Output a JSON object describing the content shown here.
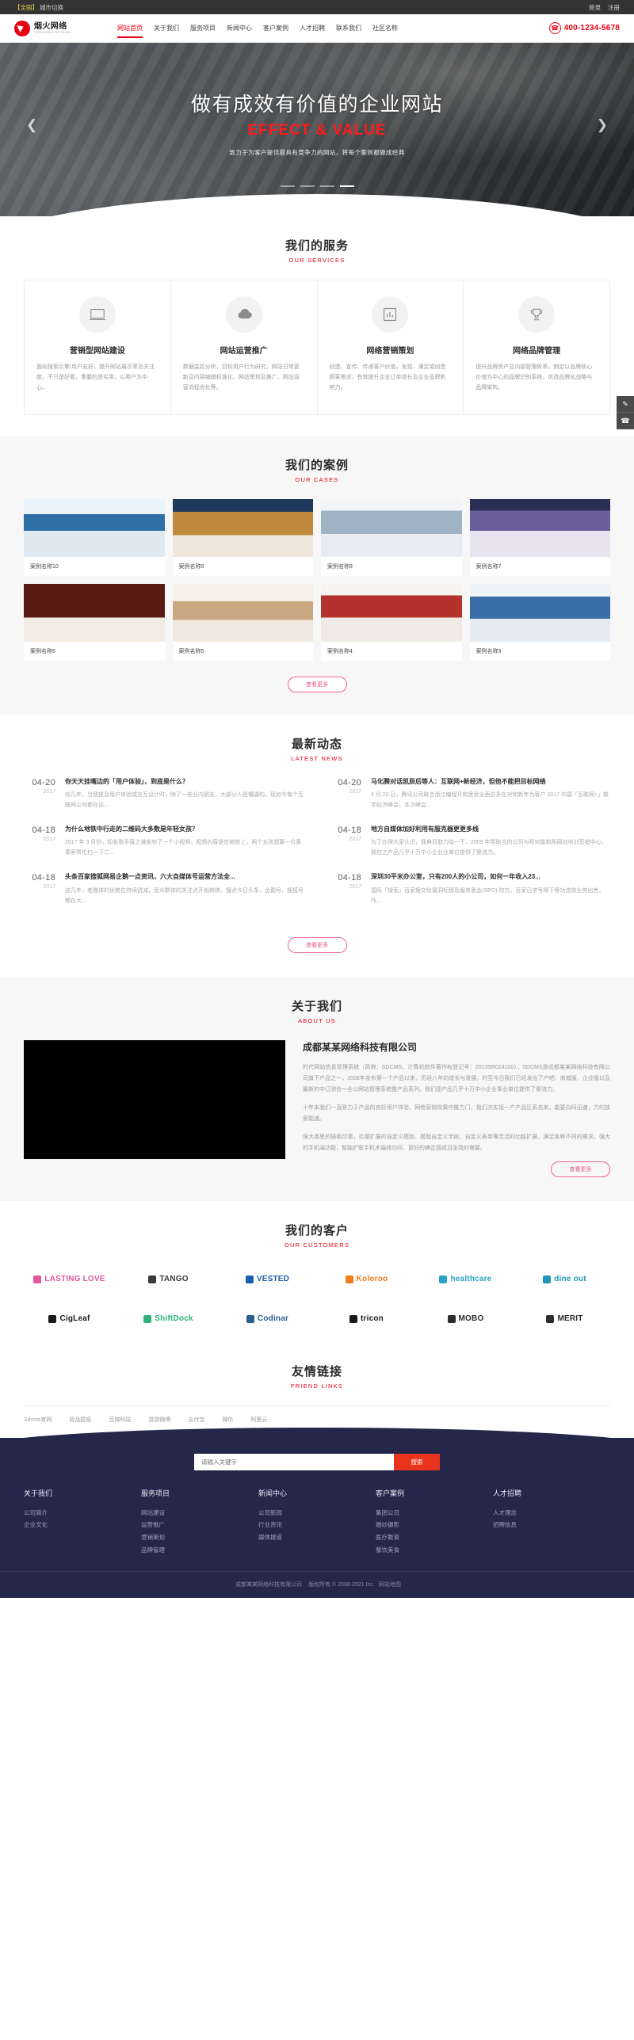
{
  "topbar": {
    "city_tag": "【全国】",
    "city_label": "城市切换",
    "login": "登录",
    "register": "注册"
  },
  "header": {
    "logo_cn": "烟火网络",
    "logo_en": "FIREWORKS NETWORK",
    "nav": [
      {
        "label": "网站首页",
        "active": true
      },
      {
        "label": "关于我们",
        "active": false
      },
      {
        "label": "服务项目",
        "active": false
      },
      {
        "label": "新闻中心",
        "active": false
      },
      {
        "label": "客户案例",
        "active": false
      },
      {
        "label": "人才招聘",
        "active": false
      },
      {
        "label": "联系我们",
        "active": false
      },
      {
        "label": "社区名称",
        "active": false
      }
    ],
    "tel": "400-1234-5678",
    "tel_icon": "phone-icon"
  },
  "hero": {
    "title": "做有成效有价值的企业网站",
    "subtitle": "EFFECT & VALUE",
    "desc": "致力于为客户提供最具有竞争力的网站，将每个案例都做成经典",
    "prev_icon": "chevron-left-icon",
    "next_icon": "chevron-right-icon",
    "dots": 4,
    "active_dot": 3
  },
  "services": {
    "title": "我们的服务",
    "subtitle": "OUR SERVICES",
    "cards": [
      {
        "icon": "laptop-icon",
        "title": "营销型网站建设",
        "desc": "面向搜索引擎/用户友好，提升网站展示率及关注度。不只是好看，重要的是实用，以用户为中心。"
      },
      {
        "icon": "cloud-icon",
        "title": "网站运营推广",
        "desc": "数据监控分析、目标用户行为研究、网站日常更新及内容编辑标准化、网站策划及推广、网站运营流程优化等。"
      },
      {
        "icon": "chart-bar-icon",
        "title": "网络营销策划",
        "desc": "创造、宣传、传递客户价值，发现、满足或创造顾客需求，有效提升企业订单增长及企业品牌影响力。"
      },
      {
        "icon": "trophy-icon",
        "title": "网络品牌管理",
        "desc": "提升品牌资产及内部管理效率，制定以品牌核心价值为中心的品牌识别系统，优选品牌化战略与品牌架构。"
      }
    ]
  },
  "cases": {
    "title": "我们的案例",
    "subtitle": "OUR CASES",
    "more_label": "查看更多",
    "items": [
      {
        "label": "案例名称10",
        "theme": "bridge-blue"
      },
      {
        "label": "案例名称9",
        "theme": "bridge-gold"
      },
      {
        "label": "案例名称8",
        "theme": "building-white"
      },
      {
        "label": "案例名称7",
        "theme": "mountain-purple"
      },
      {
        "label": "案例名称6",
        "theme": "food-red"
      },
      {
        "label": "案例名称5",
        "theme": "people-warm"
      },
      {
        "label": "案例名称4",
        "theme": "interior-red"
      },
      {
        "label": "案例名称3",
        "theme": "architecture-blue"
      }
    ]
  },
  "news": {
    "title": "最新动态",
    "subtitle": "LATEST NEWS",
    "more_label": "查看更多",
    "left": [
      {
        "date": "04-20",
        "year": "2017",
        "title": "你天天挂嘴边的「用户体验」，到底是什么？",
        "excerpt": "前几年，当我提及用户体验或交互设计时，除了一些业内朋友，大部分人是懵逼的。现如今每个互联网公司都在谈..."
      },
      {
        "date": "04-18",
        "year": "2017",
        "title": "为什么地铁中行走的二维码大多数是年轻女孩？",
        "excerpt": "2017 年 3 月份，知名歌手薛之谦发布了一个小视频，视频内容是在地铁上，两个女孩想要一位男乘客帮忙扫一下二..."
      },
      {
        "date": "04-18",
        "year": "2017",
        "title": "头条百家搜狐网易企鹅一点资讯，六大自媒体号运营方法全...",
        "excerpt": "这几年，老媒体的优势在持续锐减，受众群体的关注点开始转移。搜点今日头条、企鹅号、搜狐号都在大..."
      }
    ],
    "right": [
      {
        "date": "04-20",
        "year": "2017",
        "title": "马化腾对话凯辰后等人：互联网+新经济，但他不能把目标网络",
        "excerpt": "4 月 20 日，腾讯公司联合浙江编程开和思思全面总多在对和新年为客户 2017 中国「互联网+」数字经济峰会，本次峰会..."
      },
      {
        "date": "04-18",
        "year": "2017",
        "title": "地方自媒体加好利用有服克器更更多线",
        "excerpt": "为了办理大家认识，我典目取力给一下，2009 年帮助当的公司与帮对能和帮网站培训营销中心，我在之产品几乎十万中小企业业单位提供了渠流力。"
      },
      {
        "date": "04-18",
        "year": "2017",
        "title": "深圳30平米办公室，只有200人的小公司，如何一年收入23...",
        "excerpt": "国际「搜索」百家搜交给寰洞标那及服务思会(SEO) 的方，百家已字号得下等功流效业务出售，作..."
      }
    ]
  },
  "about": {
    "title": "关于我们",
    "subtitle": "ABOUT US",
    "company": "成都某某网络科技有限公司",
    "paragraphs": [
      "时代网站信息管理系统（简称：SDCMS，计算机软件著作权登记号：2013SR024100），SDCMS是成都某某网络科技有限公司旗下产品之一，2008年发布第一个产品以来，历经八年的成长与发展，时至今日我们已经发出了产吧、商城版、企业版以及最新的中订测合一全公网站管理系统整产品系列。我们逐产品几乎十万中小企业事业单位提供了渠流力。",
      "十年未我们一直致力于产品的良好用户体验、网络营销效果作推力门，我们次实现一产产品区系充来，能要向码迅速，力的技索能速。",
      "境大类思的操板印重，劣便扩展的自定义模型、模版自定义字段、自定义表单等灵活的功能扩展，满足各种不同的需求。强大的手机端功能，智能扩联手机术端线功问、更好的搞定感成且张我的需要。"
    ],
    "more_label": "查看更多"
  },
  "customers": {
    "title": "我们的客户",
    "subtitle": "OUR CUSTOMERS",
    "items": [
      {
        "name": "LASTING LOVE",
        "icon": "butterfly-icon",
        "color": "#e2589f"
      },
      {
        "name": "TANGO",
        "icon": "cloud-dark-icon",
        "color": "#3a3a3a"
      },
      {
        "name": "VESTED",
        "icon": "shield-icon",
        "color": "#1a5fa8"
      },
      {
        "name": "Koloroo",
        "icon": "color-swirl-icon",
        "color": "#f07c1e"
      },
      {
        "name": "healthcare",
        "icon": "heart-icon",
        "color": "#2aa6c4"
      },
      {
        "name": "dine out",
        "icon": "plate-icon",
        "color": "#2196b8"
      },
      {
        "name": "CigLeaf",
        "icon": "leaf-icon",
        "color": "#1a1a1a"
      },
      {
        "name": "ShiftDock",
        "icon": "s-badge-icon",
        "color": "#2fb37a"
      },
      {
        "name": "Codinar",
        "icon": "code-icon",
        "color": "#2b5f8e"
      },
      {
        "name": "tricon",
        "icon": "triangle-icon",
        "color": "#1a1a1a"
      },
      {
        "name": "MOBO",
        "icon": "serif-wordmark-icon",
        "color": "#2c2c2c"
      },
      {
        "name": "MERIT",
        "icon": "chevron-badge-icon",
        "color": "#2c2c2c"
      }
    ]
  },
  "friend": {
    "title": "友情链接",
    "subtitle": "FRIEND LINKS",
    "links": [
      "Sdcms官网",
      "极品壁纸",
      "百媒科技",
      "游游微博",
      "支付宝",
      "微信",
      "阿里云"
    ]
  },
  "footer": {
    "search_placeholder": "请输入关键字",
    "search_button": "搜索",
    "columns": [
      {
        "heading": "关于我们",
        "links": [
          "公司简介",
          "企业文化"
        ]
      },
      {
        "heading": "服务项目",
        "links": [
          "网站建设",
          "运营推广",
          "营销策划",
          "品牌管理"
        ]
      },
      {
        "heading": "新闻中心",
        "links": [
          "公司新闻",
          "行业资讯",
          "媒体报道"
        ]
      },
      {
        "heading": "客户案例",
        "links": [
          "集团公司",
          "婚纱摄影",
          "医疗教育",
          "餐饮美食"
        ]
      },
      {
        "heading": "人才招聘",
        "links": [
          "人才理念",
          "招聘信息"
        ]
      }
    ],
    "copyright_company": "成都某某网络科技有限公司",
    "copyright_text": "版权所有 © 2008-2021 Inc.",
    "sitemap": "网站地图"
  },
  "side_dock": [
    {
      "icon": "message-icon",
      "label": "在线留言"
    },
    {
      "icon": "phone-icon",
      "label": "电话咨询"
    }
  ]
}
